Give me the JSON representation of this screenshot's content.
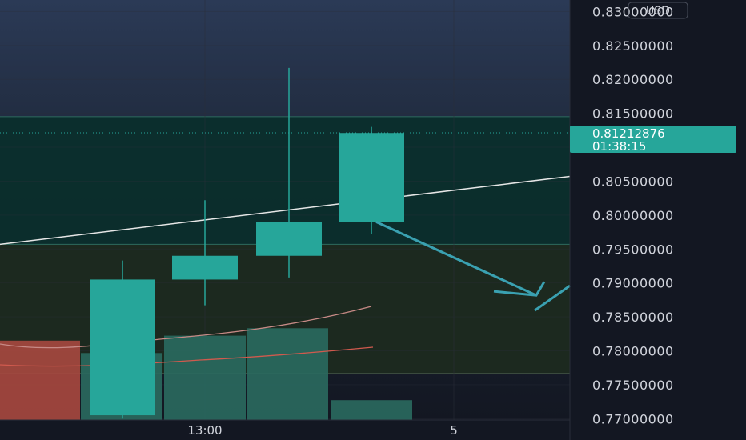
{
  "chart_data": {
    "type": "candlestick",
    "currency": "USD",
    "x_ticks": [
      "13:00",
      "5"
    ],
    "price_ticks": [
      "0.83000000",
      "0.82500000",
      "0.82000000",
      "0.81500000",
      "0.81000000",
      "0.80500000",
      "0.80000000",
      "0.79500000",
      "0.79000000",
      "0.78500000",
      "0.78000000",
      "0.77500000",
      "0.77000000"
    ],
    "ylim": [
      0.7698,
      0.8317
    ],
    "candles": [
      {
        "open": 0.7705,
        "high": 0.7933,
        "low": 0.77,
        "close": 0.7905
      },
      {
        "open": 0.7905,
        "high": 0.8022,
        "low": 0.7867,
        "close": 0.794
      },
      {
        "open": 0.794,
        "high": 0.8217,
        "low": 0.7908,
        "close": 0.799
      },
      {
        "open": 0.799,
        "high": 0.813,
        "low": 0.7972,
        "close": 0.8121
      }
    ],
    "volume": [
      {
        "direction": "down",
        "relative": 0.64
      },
      {
        "direction": "up",
        "relative": 0.54
      },
      {
        "direction": "up",
        "relative": 0.68
      },
      {
        "direction": "up",
        "relative": 0.74
      },
      {
        "direction": "up",
        "relative": 0.16
      }
    ],
    "current_price": "0.81212876",
    "countdown": "01:38:15",
    "zones": [
      {
        "name": "upper-zone",
        "top": 0.8145,
        "bottom": 0.7957,
        "color": "#0b2e2c"
      },
      {
        "name": "lower-zone",
        "top": 0.7957,
        "bottom": 0.7767,
        "color": "#1c2a1f"
      }
    ],
    "trendline": {
      "start": 0.7957,
      "end": 0.8057,
      "color": "#e6e6e6"
    },
    "arrow_target": 0.789,
    "colors": {
      "background_top": "#2b3a56",
      "background": "#131722",
      "up": "#26a69a",
      "down": "#ef5350",
      "arrow": "#3aa1b1",
      "grid": "#2a2e39"
    }
  }
}
